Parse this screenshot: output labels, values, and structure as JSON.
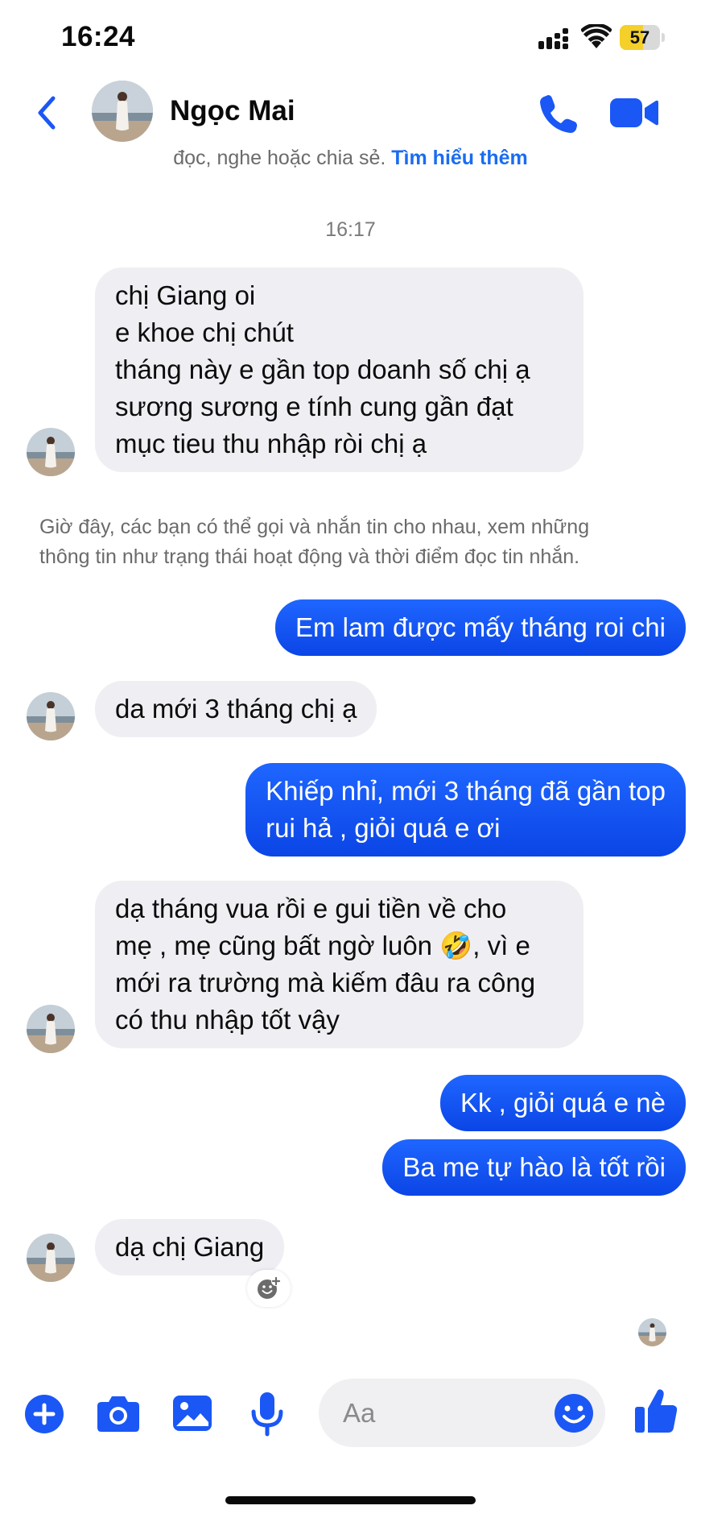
{
  "status_bar": {
    "time": "16:24",
    "battery": "57",
    "battery_level": 0.57
  },
  "header": {
    "contact_name": "Ngọc Mai"
  },
  "privacy_notice": {
    "text": "đọc, nghe hoặc chia sẻ.",
    "link": "Tìm hiểu thêm"
  },
  "timestamp": "16:17",
  "messages": [
    {
      "from": "them",
      "text": "chị Giang oi\ne khoe chị chút\ntháng này e gần top doanh số chị ạ\nsương sương e tính cung gần đạt\nmục tieu thu nhập ròi chị ạ"
    },
    {
      "from": "me",
      "text": "Em lam được mấy tháng roi chi"
    },
    {
      "from": "them",
      "text": "da mới 3 tháng chị ạ"
    },
    {
      "from": "me",
      "text": "Khiếp nhỉ, mới 3 tháng đã gần top\nrui hả , giỏi quá e ơi"
    },
    {
      "from": "them",
      "text": "dạ tháng vua rồi e gui tiền về cho\nmẹ , mẹ cũng bất ngờ luôn 🤣, vì e\nmới ra trường mà kiếm đâu ra công\ncó thu nhập tốt vậy"
    },
    {
      "from": "me",
      "text": "Kk , giỏi quá e nè"
    },
    {
      "from": "me",
      "text": "Ba me tự hào là tốt rồi"
    },
    {
      "from": "them",
      "text": "dạ chị Giang"
    }
  ],
  "system_notice": "Giờ đây, các bạn có thể gọi và nhắn tin cho nhau, xem những\nthông tin như trạng thái hoạt động và thời điểm đọc tin nhắn.",
  "composer": {
    "placeholder": "Aa"
  },
  "colors": {
    "accent": "#1a57f5",
    "outgoing_bubble": "#1f66ff",
    "incoming_bubble": "#efeff3"
  },
  "icons": [
    "back-chevron-icon",
    "phone-icon",
    "video-camera-icon",
    "add-reaction-icon",
    "plus-icon",
    "camera-icon",
    "image-icon",
    "microphone-icon",
    "smile-icon",
    "thumbs-up-icon"
  ]
}
